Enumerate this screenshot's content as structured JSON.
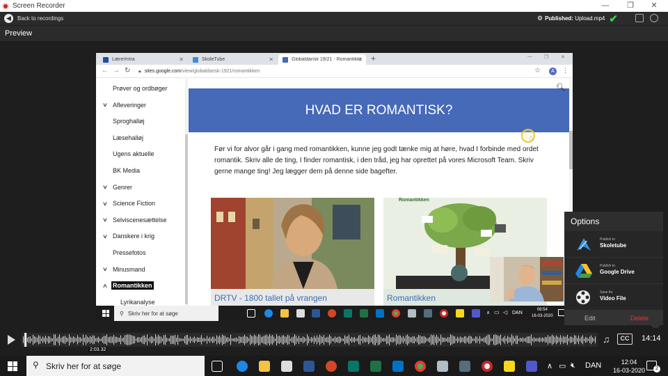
{
  "app": {
    "title": "Screen Recorder",
    "back_label": "Back to recordings",
    "published_prefix": "Published:",
    "published_file": "Upload.mp4",
    "section_label": "Preview"
  },
  "browser": {
    "tabs": [
      {
        "label": "LærerIntra",
        "color": "#1a4fa0"
      },
      {
        "label": "SkoleTube",
        "color": "#3a8fd8"
      },
      {
        "label": "Globaldansk 19/21 - Romantikke...",
        "color": "#4669b8"
      }
    ],
    "url_host": "sites.google.com",
    "url_path": "/view/globaldansk-1921/romantikken",
    "account_initial": "A"
  },
  "sidebar": {
    "items": [
      {
        "label": "Prøver og ordbøger",
        "chevron": false,
        "indent": 24
      },
      {
        "label": "Afleveringer",
        "chevron": true,
        "indent": 24
      },
      {
        "label": "Sproghalløj",
        "chevron": false,
        "indent": 24
      },
      {
        "label": "Læsehalløj",
        "chevron": false,
        "indent": 24
      },
      {
        "label": "Ugens aktuelle",
        "chevron": false,
        "indent": 24
      },
      {
        "label": "BK Media",
        "chevron": false,
        "indent": 24
      },
      {
        "label": "Genrer",
        "chevron": true,
        "indent": 24
      },
      {
        "label": "Science Fiction",
        "chevron": true,
        "indent": 24
      },
      {
        "label": "Selviscenesættelse",
        "chevron": true,
        "indent": 24
      },
      {
        "label": "Danskere i krig",
        "chevron": true,
        "indent": 24
      },
      {
        "label": "Pressefotos",
        "chevron": false,
        "indent": 24
      },
      {
        "label": "Minusmand",
        "chevron": true,
        "indent": 24
      },
      {
        "label": "Romantikken",
        "chevron": true,
        "indent": 22,
        "selected": true,
        "open": true
      },
      {
        "label": "Lyrikanalyse",
        "chevron": false,
        "indent": 35
      }
    ]
  },
  "page": {
    "heading": "HVAD ER ROMANTISK?",
    "paragraph": "Før vi for alvor går i gang med romantikken, kunne jeg godt tænke mig at høre, hvad I forbinde med ordet romantik. Skriv alle de ting, I finder romantisk, i den tråd, jeg har oprettet på vores Microsoft Team. Skriv gerne mange ting! Jeg lægger dem på denne side bagefter.",
    "cards": [
      {
        "title": "DRTV - 1800 tallet på vrangen"
      },
      {
        "title": "Romantikken",
        "image_caption": "Romantikken"
      }
    ]
  },
  "inner_taskbar": {
    "search_placeholder": "Skriv her for at søge",
    "language": "DAN",
    "time": "08:54",
    "date": "16-03-2020"
  },
  "options": {
    "title": "Options",
    "items": [
      {
        "small": "Publish to",
        "big": "Skoletube",
        "icon": "skoletube-icon"
      },
      {
        "small": "Publish to",
        "big": "Google Drive",
        "icon": "google-drive-icon"
      },
      {
        "small": "Save As",
        "big": "Video File",
        "icon": "film-reel-icon"
      }
    ],
    "edit_label": "Edit",
    "delete_label": "Delete"
  },
  "timeline": {
    "position": "2:03.32",
    "duration": "14:14",
    "played_fraction": 0.005,
    "cc_label": "CC"
  },
  "taskbar": {
    "search_placeholder": "Skriv her for at søge",
    "language": "DAN",
    "time": "12:04",
    "date": "16-03-2020",
    "notifications": "2"
  },
  "colors": {
    "banner": "#4669b8",
    "link": "#3b6cb3",
    "published_tick": "#3ccf52",
    "delete": "#e53935"
  }
}
